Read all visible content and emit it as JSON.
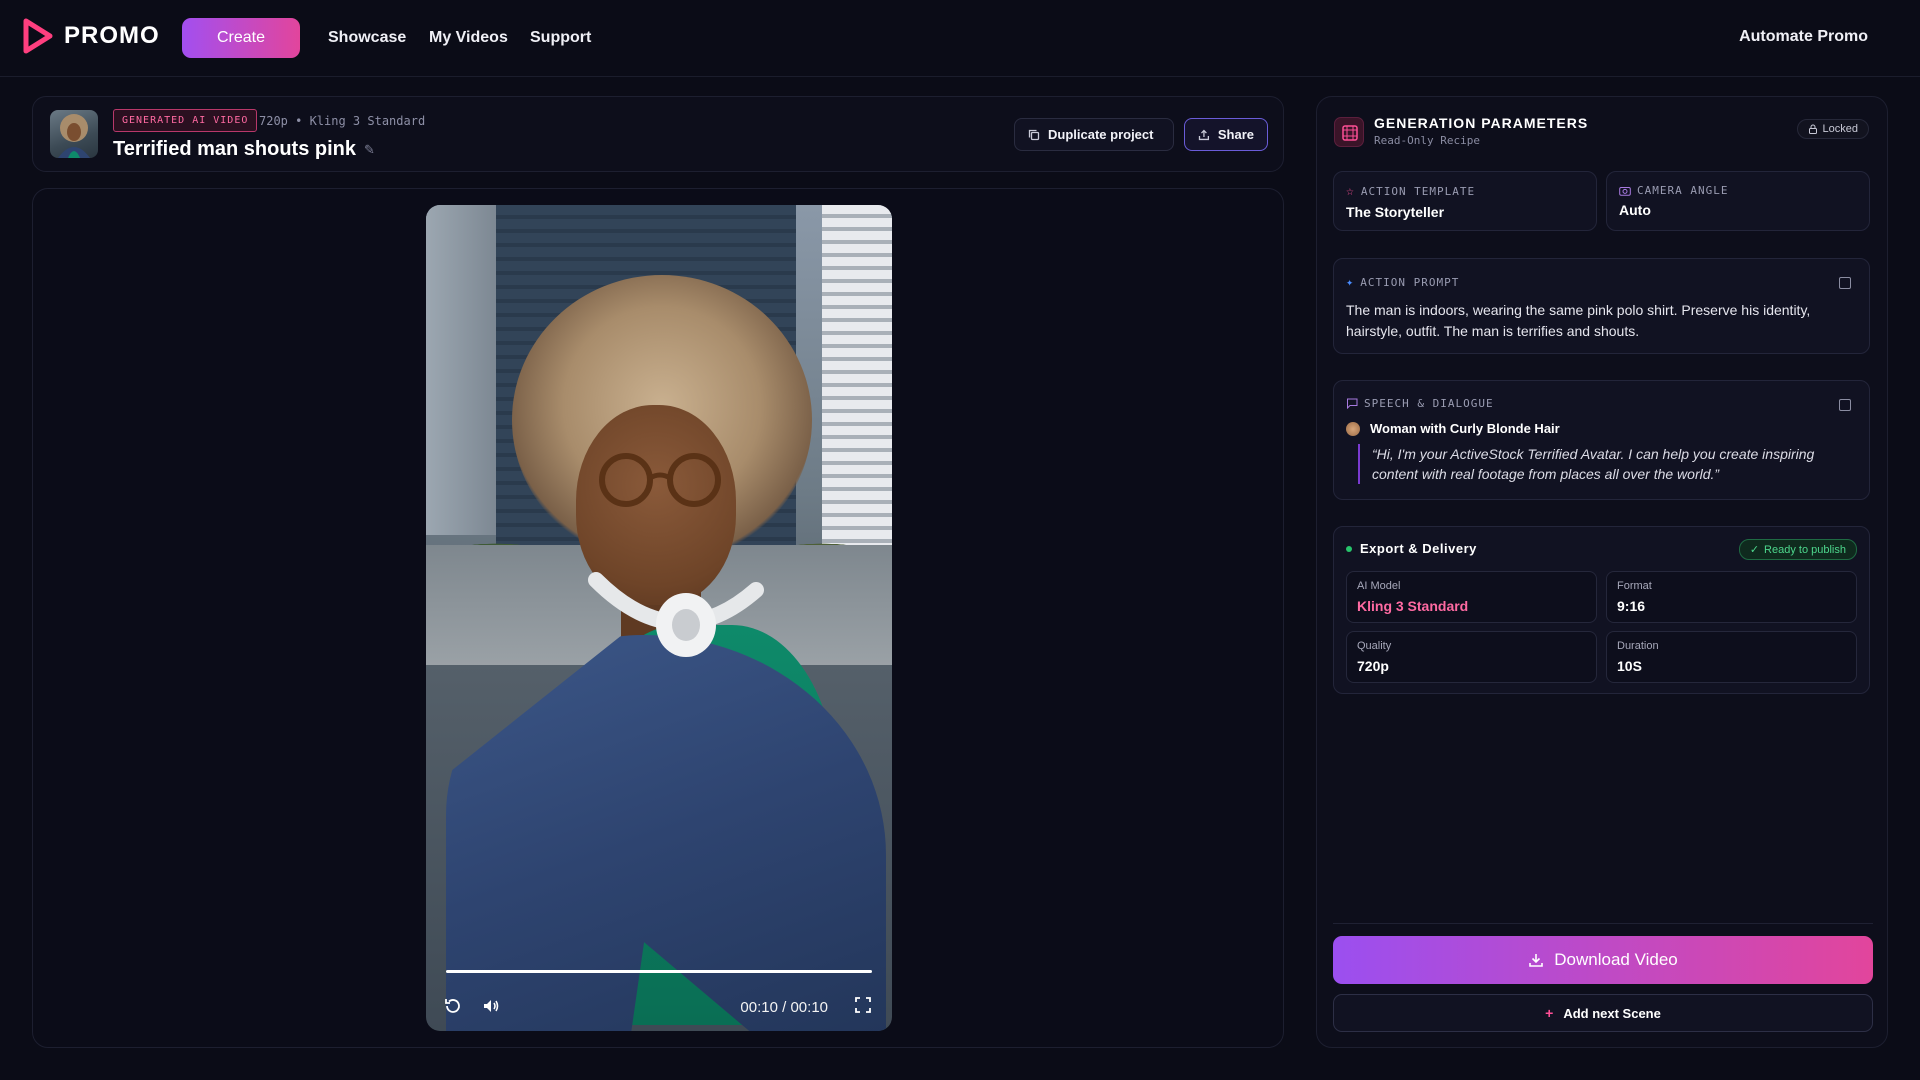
{
  "brand": {
    "name": "PROMO",
    "accent": "#e2459c",
    "accent2": "#a24ff0"
  },
  "nav": {
    "create": "Create",
    "showcase": "Showcase",
    "my_videos": "My Videos",
    "support": "Support",
    "automate": "Automate Promo"
  },
  "project": {
    "badge": "GENERATED AI VIDEO",
    "meta": "720p • Kling 3 Standard",
    "title": "Terrified man shouts pink",
    "duplicate_label": "Duplicate project",
    "share_label": "Share"
  },
  "player": {
    "time": "00:10 / 00:10",
    "progress": 1.0,
    "icons": [
      "replay-icon",
      "volume-icon",
      "fullscreen-icon"
    ]
  },
  "params": {
    "title": "GENERATION PARAMETERS",
    "subtitle": "Read-Only Recipe",
    "locked": "Locked",
    "action_template": {
      "label": "ACTION TEMPLATE",
      "value": "The Storyteller"
    },
    "camera_angle": {
      "label": "CAMERA ANGLE",
      "value": "Auto"
    },
    "action_prompt": {
      "label": "ACTION PROMPT",
      "text": "The man is indoors, wearing the same pink polo shirt. Preserve his identity, hairstyle, outfit. The man is terrifies and shouts."
    },
    "speech": {
      "label": "SPEECH & DIALOGUE",
      "speaker": "Woman with Curly Blonde Hair",
      "quote": "“Hi, I'm your ActiveStock Terrified Avatar. I can help you create inspiring content with real footage from places all over the world.”"
    },
    "export": {
      "title": "Export & Delivery",
      "status": "Ready to publish",
      "ai_model": {
        "label": "AI Model",
        "value": "Kling 3 Standard"
      },
      "format": {
        "label": "Format",
        "value": "9:16"
      },
      "quality": {
        "label": "Quality",
        "value": "720p"
      },
      "duration": {
        "label": "Duration",
        "value": "10S"
      }
    },
    "download": "Download Video",
    "add_scene": "Add next Scene"
  }
}
